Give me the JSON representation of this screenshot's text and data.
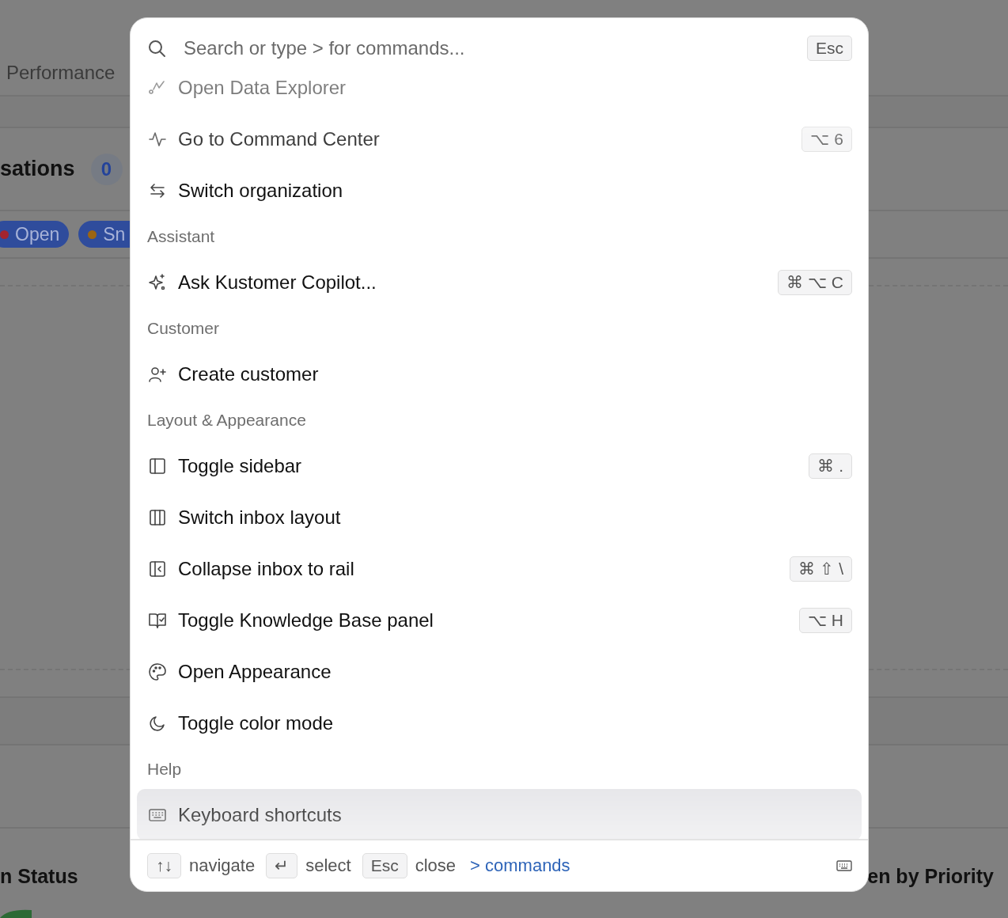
{
  "background": {
    "tab": "Performance",
    "section_title": "sations",
    "count": "0",
    "pills": [
      {
        "label": "Open",
        "color": "#a3242e"
      },
      {
        "label": "Sn",
        "color": "#9c6512"
      }
    ],
    "bottom_left_title": "n Status",
    "bottom_right_title": "en by Priority"
  },
  "palette": {
    "search": {
      "placeholder": "Search or type > for commands..."
    },
    "close_key": "Esc",
    "items": [
      {
        "kind": "command",
        "label": "Open Data Explorer",
        "selected": false
      },
      {
        "kind": "command",
        "label": "Go to Command Center",
        "shortcut": "⌥ 6",
        "selected": false
      },
      {
        "kind": "command",
        "label": "Switch organization",
        "selected": false
      },
      {
        "kind": "header",
        "label": "Assistant"
      },
      {
        "kind": "command",
        "label": "Ask Kustomer Copilot...",
        "shortcut": "⌘ ⌥ C",
        "selected": false
      },
      {
        "kind": "header",
        "label": "Customer"
      },
      {
        "kind": "command",
        "label": "Create customer",
        "selected": false
      },
      {
        "kind": "header",
        "label": "Layout & Appearance"
      },
      {
        "kind": "command",
        "label": "Toggle sidebar",
        "shortcut": "⌘ .",
        "selected": false
      },
      {
        "kind": "command",
        "label": "Switch inbox layout",
        "selected": false
      },
      {
        "kind": "command",
        "label": "Collapse inbox to rail",
        "shortcut": "⌘ ⇧ \\",
        "selected": false
      },
      {
        "kind": "command",
        "label": "Toggle Knowledge Base panel",
        "shortcut": "⌥ H",
        "selected": false
      },
      {
        "kind": "command",
        "label": "Open Appearance",
        "selected": false
      },
      {
        "kind": "command",
        "label": "Toggle color mode",
        "selected": false
      },
      {
        "kind": "header",
        "label": "Help"
      },
      {
        "kind": "command",
        "label": "Keyboard shortcuts",
        "selected": true
      }
    ],
    "footer": {
      "hints": [
        {
          "key": "↑↓",
          "label": "navigate"
        },
        {
          "key": "↵",
          "label": "select"
        },
        {
          "key": "Esc",
          "label": "close"
        }
      ],
      "link": "> commands"
    }
  }
}
